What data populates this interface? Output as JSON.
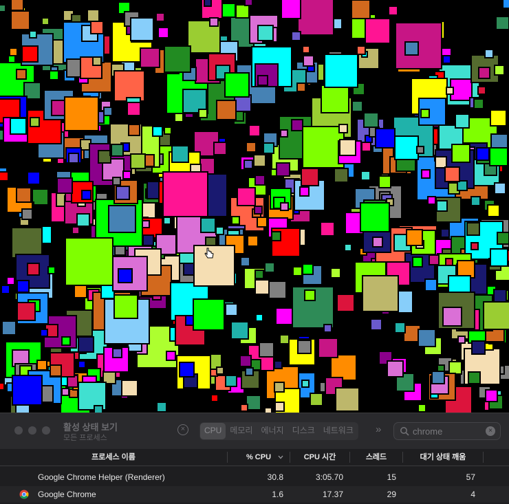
{
  "app": {
    "title": "활성 상태 보기",
    "subtitle": "모든 프로세스"
  },
  "toolbar": {
    "stop_symbol": "×",
    "more_symbol": "»",
    "tabs": [
      {
        "label": "CPU",
        "active": true
      },
      {
        "label": "메모리",
        "active": false
      },
      {
        "label": "에너지",
        "active": false
      },
      {
        "label": "디스크",
        "active": false
      },
      {
        "label": "네트워크",
        "active": false
      }
    ]
  },
  "search": {
    "value": "chrome",
    "clear_symbol": "×"
  },
  "table": {
    "columns": {
      "name": "프로세스 이름",
      "cpu": "% CPU",
      "cpu_time": "CPU 시간",
      "threads": "스레드",
      "idle_wakeups": "대기 상태 깨움"
    },
    "sort": {
      "column": "cpu",
      "direction": "descending"
    },
    "rows": [
      {
        "name": "Google Chrome Helper (Renderer)",
        "cpu": "30.8",
        "cpu_time": "3:05.70",
        "threads": "15",
        "idle_wakeups": "57",
        "icon": "none"
      },
      {
        "name": "Google Chrome",
        "cpu": "1.6",
        "cpu_time": "17.37",
        "threads": "29",
        "idle_wakeups": "4",
        "icon": "chrome-icon"
      }
    ]
  },
  "canvas": {
    "description_icon": "hand-pointer-cursor",
    "palette": [
      "#ff00ff",
      "#00ff00",
      "#0000ff",
      "#ffff00",
      "#00ffff",
      "#ff0000",
      "#808080",
      "#556b2f",
      "#2e8b57",
      "#8b008b",
      "#4682b4",
      "#ff6347",
      "#9acd32",
      "#da70d6",
      "#20b2aa",
      "#ff1493",
      "#1e90ff",
      "#adff2f",
      "#d2691e",
      "#191970",
      "#bdb76b",
      "#40e0d0",
      "#ff8c00",
      "#7fff00",
      "#c71585",
      "#6a5acd",
      "#f5deb3",
      "#228b22",
      "#dc143c",
      "#87cefa"
    ]
  }
}
